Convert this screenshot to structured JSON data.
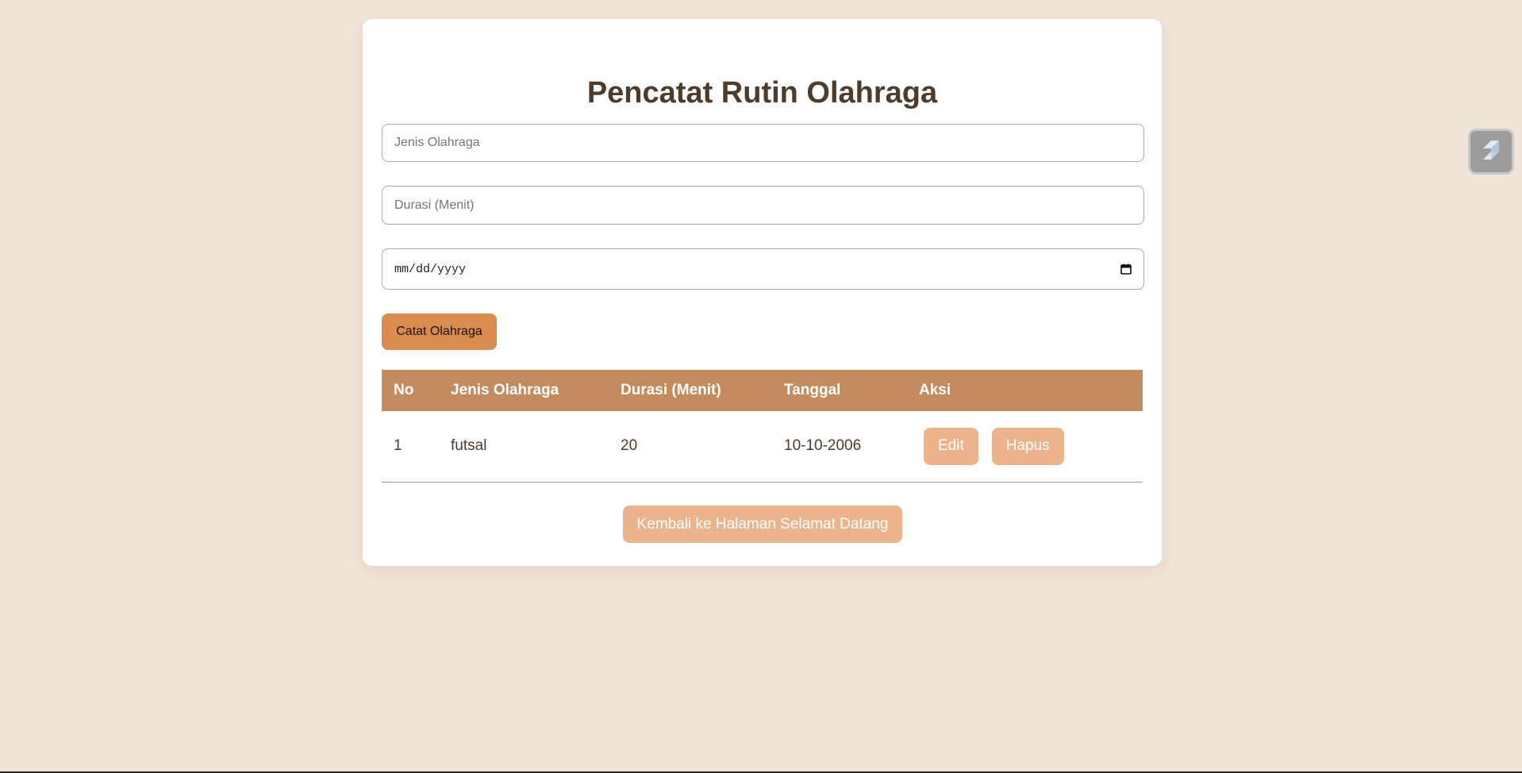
{
  "header": {
    "title": "Pencatat Rutin Olahraga"
  },
  "form": {
    "jenis_placeholder": "Jenis Olahraga",
    "jenis_value": "",
    "durasi_placeholder": "Durasi (Menit)",
    "durasi_value": "",
    "date_placeholder": "mm/dd/yyyy",
    "date_icon": "calendar-icon",
    "submit_label": "Catat Olahraga"
  },
  "table": {
    "columns": [
      "No",
      "Jenis Olahraga",
      "Durasi (Menit)",
      "Tanggal",
      "Aksi"
    ],
    "rows": [
      {
        "no": "1",
        "jenis": "futsal",
        "durasi": "20",
        "tanggal": "10-10-2006",
        "edit_label": "Edit",
        "hapus_label": "Hapus"
      }
    ]
  },
  "footer": {
    "back_label": "Kembali ke Halaman Selamat Datang"
  },
  "widget": {
    "icon": "extension-icon"
  },
  "colors": {
    "background": "#f1e4d8",
    "card": "#ffffff",
    "title_text": "#4d3b2c",
    "primary_button": "#d88c4f",
    "table_header": "#c48b5e",
    "secondary_button": "#ebb48d"
  }
}
